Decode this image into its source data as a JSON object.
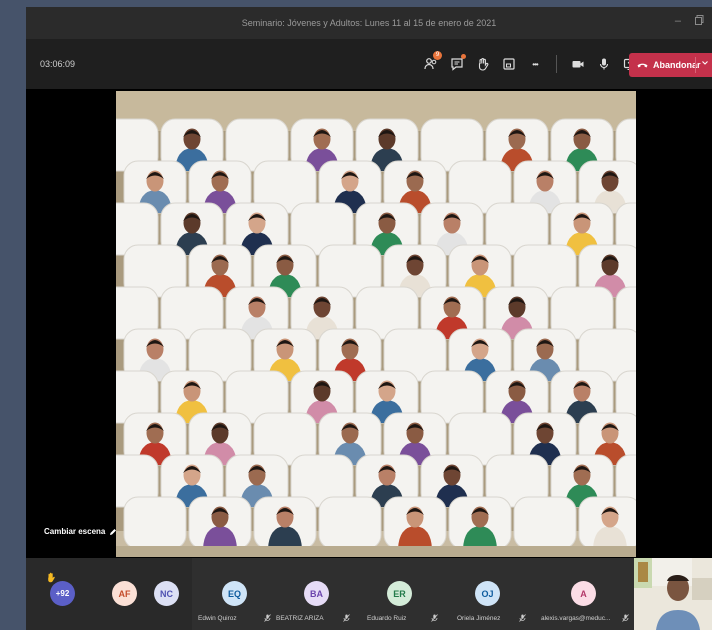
{
  "window": {
    "title": "Seminario: Jóvenes y Adultos: Lunes 11 al 15 de enero de 2021"
  },
  "toolbar": {
    "timer": "03:06:09",
    "participants_count": "9",
    "leave_label": "Abandonar",
    "more_label": "•••"
  },
  "stage": {
    "change_scene_label": "Cambiar escena"
  },
  "strip": {
    "overflow_count": "+92",
    "participants": [
      {
        "initials": "AF",
        "name": "",
        "color": "#fbe0d6",
        "text_color": "#c44d2c"
      },
      {
        "initials": "NC",
        "name": "",
        "color": "#dce0f4",
        "text_color": "#4f52b2"
      },
      {
        "initials": "EQ",
        "name": "Edwin Quiroz",
        "color": "#cfe4f7",
        "text_color": "#0f5c9e"
      },
      {
        "initials": "BA",
        "name": "BEATRIZ ARIZA",
        "color": "#e6dcf6",
        "text_color": "#6b44ad"
      },
      {
        "initials": "ER",
        "name": "Eduardo Ruiz",
        "color": "#d4ecd9",
        "text_color": "#237b4b"
      },
      {
        "initials": "OJ",
        "name": "Oriela Jiménez",
        "color": "#cfe4f7",
        "text_color": "#0f5c9e"
      },
      {
        "initials": "A",
        "name": "alexis.vargas@meduc...",
        "color": "#fbdde6",
        "text_color": "#b4396a"
      }
    ]
  },
  "colors": {
    "accent_leave": "#c4314b",
    "toolbar_bg": "#1f1f1f",
    "strip_bg": "#292929",
    "hand_raise": "#f5b922"
  }
}
